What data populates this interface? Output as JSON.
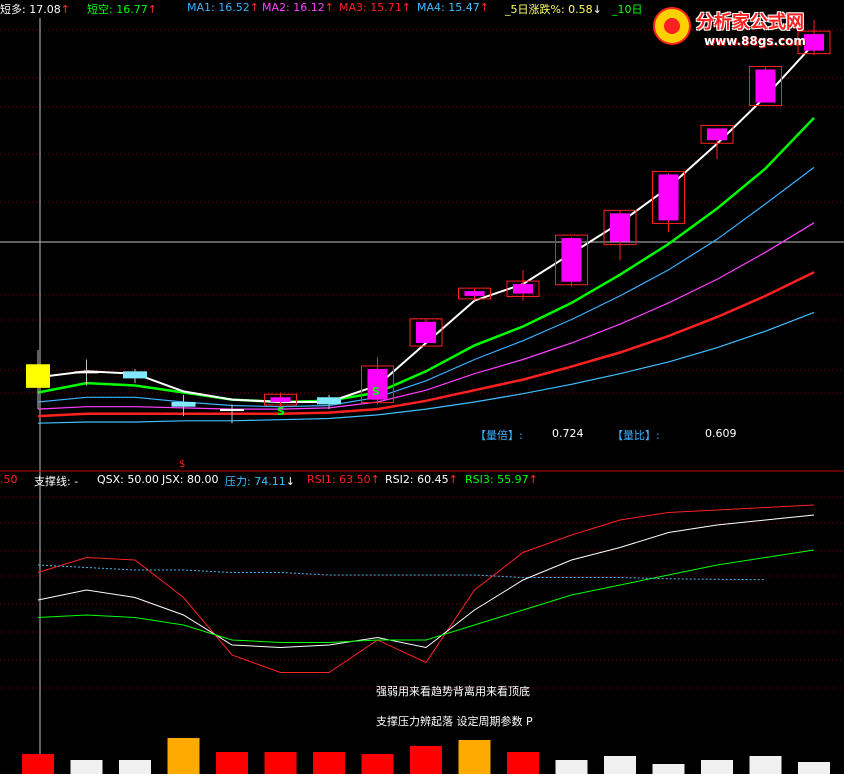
{
  "header": {
    "items": [
      {
        "label": "短多",
        "value": "17.08",
        "arrow": "↑",
        "color": "#ffffff"
      },
      {
        "label": "短空",
        "value": "16.77",
        "arrow": "↑",
        "color": "#00ff00"
      },
      {
        "label": "MA1",
        "value": "16.52",
        "arrow": "↑",
        "color": "#3ab0ff"
      },
      {
        "label": "MA2",
        "value": "16.12",
        "arrow": "↑",
        "color": "#ff40ff"
      },
      {
        "label": "MA3",
        "value": "15.71",
        "arrow": "↑",
        "color": "#ff2020"
      },
      {
        "label": "MA4",
        "value": "15.47",
        "arrow": "↑",
        "color": "#40c0ff"
      },
      {
        "label": "_5日涨跌%",
        "value": "0.58",
        "arrow": "↓",
        "color": "#ffff60"
      },
      {
        "label": "_10日",
        "value": "",
        "arrow": "",
        "color": "#00ff00"
      }
    ]
  },
  "logo": {
    "name": "分析家公式网",
    "url": "www.88gs.com"
  },
  "ratios": {
    "liangbei_label": "【量倍】:",
    "liangbei_value": "0.724",
    "liangbi_label": "【量比】:",
    "liangbi_value": "0.609"
  },
  "signals": {
    "s_label": "S",
    "s_marker": "$"
  },
  "lower_header": {
    "items": [
      {
        "label": "",
        "value": ".50",
        "arrow": "",
        "color": "#ff2020"
      },
      {
        "label": "支撑线",
        "value": "-",
        "arrow": "",
        "color": "#ffffff"
      },
      {
        "label": "QSX",
        "value": "50.00",
        "arrow": "",
        "color": "#ffffff"
      },
      {
        "label": "JSX",
        "value": "80.00",
        "arrow": "",
        "color": "#ffffff"
      },
      {
        "label": "压力",
        "value": "74.11",
        "arrow": "↓",
        "color": "#40c0ff"
      },
      {
        "label": "RSI1",
        "value": "63.50",
        "arrow": "↑",
        "color": "#ff2020"
      },
      {
        "label": "RSI2",
        "value": "60.45",
        "arrow": "↑",
        "color": "#ffffff"
      },
      {
        "label": "RSI3",
        "value": "55.97",
        "arrow": "↑",
        "color": "#00ff00"
      }
    ]
  },
  "captions": {
    "line1": "强弱用来看趋势背离用来看顶底",
    "line2": "支撑压力辨起落 设定周期参数 P"
  },
  "colors": {
    "bg": "#000000",
    "grid": "#800000",
    "up_candle": "#ff00ff",
    "up_outline": "#ff2020",
    "down_candle": "#00e0ff",
    "short_long": "#ffffff",
    "short_short": "#00ff00",
    "ma1": "#3ab0ff",
    "ma2": "#ff40ff",
    "ma3": "#ff2020",
    "ma4": "#40c0ff"
  },
  "chart_data": [
    {
      "type": "candlestick",
      "title": "",
      "n": 17,
      "ylim": [
        13.8,
        17.6
      ],
      "candles": [
        {
          "o": 14.48,
          "c": 14.68,
          "h": 14.8,
          "l": 14.3,
          "color": "yellow"
        },
        {
          "o": 14.62,
          "c": 14.62,
          "h": 14.72,
          "l": 14.5,
          "color": "white"
        },
        {
          "o": 14.62,
          "c": 14.56,
          "h": 14.64,
          "l": 14.52,
          "color": "cyan"
        },
        {
          "o": 14.36,
          "c": 14.32,
          "h": 14.42,
          "l": 14.24,
          "color": "cyan"
        },
        {
          "o": 14.3,
          "c": 14.3,
          "h": 14.34,
          "l": 14.18,
          "color": "white"
        },
        {
          "o": 14.36,
          "c": 14.4,
          "h": 14.44,
          "l": 14.32,
          "color": "magenta"
        },
        {
          "o": 14.4,
          "c": 14.34,
          "h": 14.42,
          "l": 14.3,
          "color": "cyan"
        },
        {
          "o": 14.38,
          "c": 14.64,
          "h": 14.74,
          "l": 14.34,
          "color": "magenta"
        },
        {
          "o": 14.86,
          "c": 15.04,
          "h": 15.06,
          "l": 14.86,
          "color": "magenta"
        },
        {
          "o": 15.26,
          "c": 15.3,
          "h": 15.32,
          "l": 15.22,
          "color": "magenta"
        },
        {
          "o": 15.28,
          "c": 15.36,
          "h": 15.48,
          "l": 15.22,
          "color": "magenta"
        },
        {
          "o": 15.38,
          "c": 15.75,
          "h": 15.76,
          "l": 15.34,
          "color": "magenta"
        },
        {
          "o": 15.72,
          "c": 15.96,
          "h": 15.98,
          "l": 15.56,
          "color": "magenta"
        },
        {
          "o": 15.9,
          "c": 16.29,
          "h": 16.3,
          "l": 15.8,
          "color": "magenta"
        },
        {
          "o": 16.58,
          "c": 16.68,
          "h": 16.68,
          "l": 16.42,
          "color": "magenta"
        },
        {
          "o": 16.9,
          "c": 17.18,
          "h": 17.2,
          "l": 16.9,
          "color": "magenta"
        },
        {
          "o": 17.34,
          "c": 17.48,
          "h": 17.6,
          "l": 17.3,
          "color": "magenta"
        }
      ],
      "series": [
        {
          "name": "短多",
          "color": "#ffffff",
          "values": [
            14.57,
            14.62,
            14.6,
            14.45,
            14.38,
            14.36,
            14.36,
            14.5,
            14.86,
            15.22,
            15.36,
            15.62,
            15.88,
            16.18,
            16.55,
            16.95,
            17.4
          ]
        },
        {
          "name": "短空",
          "color": "#00ff00",
          "values": [
            14.44,
            14.52,
            14.5,
            14.44,
            14.38,
            14.36,
            14.37,
            14.44,
            14.62,
            14.84,
            15.0,
            15.2,
            15.44,
            15.7,
            16.0,
            16.34,
            16.77
          ]
        },
        {
          "name": "MA1",
          "color": "#3ab0ff",
          "values": [
            14.36,
            14.4,
            14.4,
            14.36,
            14.33,
            14.32,
            14.33,
            14.4,
            14.54,
            14.72,
            14.88,
            15.06,
            15.26,
            15.48,
            15.74,
            16.04,
            16.35
          ]
        },
        {
          "name": "MA2",
          "color": "#ff40ff",
          "values": [
            14.3,
            14.32,
            14.32,
            14.31,
            14.3,
            14.3,
            14.31,
            14.36,
            14.46,
            14.6,
            14.72,
            14.86,
            15.02,
            15.2,
            15.4,
            15.63,
            15.88
          ]
        },
        {
          "name": "MA3",
          "color": "#ff2020",
          "values": [
            14.24,
            14.26,
            14.26,
            14.26,
            14.26,
            14.26,
            14.27,
            14.3,
            14.37,
            14.46,
            14.55,
            14.66,
            14.78,
            14.92,
            15.08,
            15.26,
            15.46
          ]
        },
        {
          "name": "MA4",
          "color": "#40c0ff",
          "values": [
            14.18,
            14.19,
            14.19,
            14.2,
            14.2,
            14.21,
            14.22,
            14.25,
            14.3,
            14.36,
            14.43,
            14.51,
            14.6,
            14.7,
            14.82,
            14.96,
            15.12
          ]
        }
      ]
    },
    {
      "type": "line",
      "title": "",
      "ylim": [
        30,
        110
      ],
      "series": [
        {
          "name": "RSI1",
          "color": "#ff2020",
          "values": [
            77,
            83,
            82,
            67,
            44,
            37,
            37,
            50,
            41,
            70,
            85,
            92,
            98,
            101,
            102,
            103,
            104
          ]
        },
        {
          "name": "RSI2",
          "color": "#ffffff",
          "values": [
            66,
            70,
            67,
            60,
            48,
            47,
            48,
            51,
            47,
            62,
            74,
            82,
            87,
            93,
            96,
            98,
            100
          ]
        },
        {
          "name": "RSI3",
          "color": "#00ff00",
          "values": [
            59,
            60,
            59,
            56,
            50,
            49,
            49,
            50,
            50,
            56,
            62,
            68,
            72,
            76,
            80,
            83,
            86
          ]
        },
        {
          "name": "压力",
          "color": "#40c0ff",
          "values": [
            80,
            79,
            78,
            78,
            77,
            77,
            76,
            76,
            76,
            76,
            75,
            75,
            75,
            74.5,
            74.3,
            74.11
          ]
        }
      ],
      "bars": [
        {
          "value": 1.0,
          "color": "red"
        },
        {
          "value": 0.7,
          "color": "white"
        },
        {
          "value": 0.7,
          "color": "white"
        },
        {
          "value": 1.8,
          "color": "orange"
        },
        {
          "value": 1.1,
          "color": "red"
        },
        {
          "value": 1.1,
          "color": "red"
        },
        {
          "value": 1.1,
          "color": "red"
        },
        {
          "value": 1.0,
          "color": "red"
        },
        {
          "value": 1.4,
          "color": "red"
        },
        {
          "value": 1.7,
          "color": "orange"
        },
        {
          "value": 1.1,
          "color": "red"
        },
        {
          "value": 0.7,
          "color": "white"
        },
        {
          "value": 0.9,
          "color": "white"
        },
        {
          "value": 0.5,
          "color": "white"
        },
        {
          "value": 0.7,
          "color": "white"
        },
        {
          "value": 0.9,
          "color": "white"
        },
        {
          "value": 0.6,
          "color": "white"
        }
      ]
    }
  ]
}
